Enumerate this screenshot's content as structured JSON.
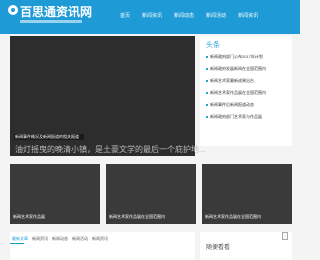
{
  "header": {
    "logo_title": "百思通资讯网",
    "nav": [
      "首页",
      "新闻资讯",
      "新闻动态",
      "新闻活动",
      "新闻资讯"
    ]
  },
  "hero": {
    "caption": "新闻事件概况及新闻报道的相关报道",
    "text": "油灯摇曳的晚清小镇，是土豪文学的最后一个庇护地..."
  },
  "sidebar": {
    "title": "头条",
    "items": [
      "新闻政府部门公布2017年计划",
      "新闻政府发展新闻在全国范围内",
      "新闻艺术家最新成果出台",
      "新闻艺术家作品展在全国范围内",
      "新闻事件后新闻报道动态",
      "新闻政府部门艺术家与作品展"
    ]
  },
  "cards": [
    "新闻艺术家作品展",
    "新闻艺术家作品展在全国范围内",
    "新闻艺术家作品展在全国范围内"
  ],
  "tabs": [
    "最新文章",
    "新闻资讯",
    "新闻动态",
    "新闻活动",
    "新闻资讯"
  ],
  "rbox": {
    "title": "随便看看"
  },
  "colors": {
    "brand": "#1e9bd6",
    "hero_bg": "#2d2d2d",
    "card_bg": "#3a3a3a"
  }
}
